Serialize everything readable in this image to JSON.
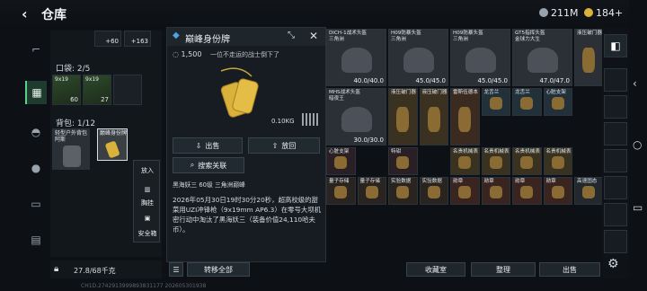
{
  "header": {
    "back_icon": "chevron-left-icon",
    "title": "仓库",
    "currency_1": "211M",
    "currency_2": "184+"
  },
  "colors": {
    "accent_green": "#58d08a",
    "gold": "#d9b13b",
    "panel": "#12171c"
  },
  "left_nav": [
    "pistol-icon",
    "backpack-icon",
    "helmet-icon",
    "grenade-icon",
    "box-icon",
    "armor-icon"
  ],
  "equipment": {
    "top_items": [
      {
        "label": "60",
        "prefix": "+"
      },
      {
        "label": "163",
        "prefix": "+"
      }
    ],
    "pouch_label": "口袋: 2/5",
    "pouch_items": [
      {
        "name": "9x19",
        "count": "60"
      },
      {
        "name": "9x19",
        "count": "27"
      }
    ],
    "backpack_label": "背包: 1/12",
    "backpack_item": "轻型户外背包",
    "backpack_item_sub": "阿斯",
    "tag_item": "巅峰身份牌",
    "weight": "27.8/68千克"
  },
  "context_menu": {
    "put_in": "放入",
    "chest_rig": "胸挂",
    "safe_box": "安全箱"
  },
  "detail": {
    "title": "巅峰身份牌",
    "price": "1,500",
    "quote": "一位不走运的战士倒下了",
    "weight": "0.10KG",
    "sell_btn": "出售",
    "put_back_btn": "放回",
    "search_btn": "搜索关联",
    "location": "黑海妖三 60级 三角洲巅峰",
    "description": "2026年05月30日19时30分20秒，超高校级的甜菜用UZI冲锋枪（9x19mm AP6.3）在零号大坝机密行动中淘汰了黑海妖三（装备价值24,110哈夫币）。",
    "transfer_all": "转移全部"
  },
  "store": {
    "items": [
      {
        "name": "DICH-1战术头盔",
        "sub": "三角洲",
        "count": "40.0/40.0"
      },
      {
        "name": "H09防暴头盔",
        "sub": "三角洲",
        "count": "45.0/45.0"
      },
      {
        "name": "H09防暴头盔",
        "sub": "三角洲",
        "count": "45.0/45.0"
      },
      {
        "name": "GT5指挥头盔",
        "sub": "金球力大生",
        "count": "47.0/47.0"
      },
      {
        "name": "液压破门器",
        "sub": "",
        "count": ""
      },
      {
        "name": "MHS战术头盔",
        "sub": "暗夜王",
        "count": "30.0/30.0"
      },
      {
        "name": "液压破门器",
        "sub": "",
        "count": ""
      },
      {
        "name": "液压破门器",
        "sub": "",
        "count": ""
      },
      {
        "name": "雷斯伍德本",
        "sub": "",
        "count": ""
      },
      {
        "name": "龙舌兰",
        "sub": "",
        "count": ""
      },
      {
        "name": "龙舌兰",
        "sub": "",
        "count": ""
      },
      {
        "name": "心脏支架",
        "sub": "",
        "count": ""
      },
      {
        "name": "心脏支架",
        "sub": "",
        "count": ""
      },
      {
        "name": "特钳",
        "sub": "",
        "count": ""
      },
      {
        "name": "名贵机械表",
        "sub": "",
        "count": ""
      },
      {
        "name": "名贵机械表",
        "sub": "",
        "count": ""
      },
      {
        "name": "名贵机械表",
        "sub": "",
        "count": ""
      },
      {
        "name": "名贵机械表",
        "sub": "",
        "count": ""
      },
      {
        "name": "量子存储",
        "sub": "",
        "count": ""
      },
      {
        "name": "量子存储",
        "sub": "",
        "count": ""
      },
      {
        "name": "实验数据",
        "sub": "",
        "count": ""
      },
      {
        "name": "实验数据",
        "sub": "",
        "count": ""
      },
      {
        "name": "勋章",
        "sub": "",
        "count": ""
      },
      {
        "name": "勋章",
        "sub": "",
        "count": ""
      },
      {
        "name": "勋章",
        "sub": "",
        "count": ""
      },
      {
        "name": "勋章",
        "sub": "",
        "count": ""
      },
      {
        "name": "高速固态",
        "sub": "",
        "count": ""
      }
    ],
    "btn_collection": "收藏室",
    "btn_organize": "整理",
    "btn_sell": "出售"
  },
  "status_line": "CH1D.2742913999893831177​ 202605301938"
}
